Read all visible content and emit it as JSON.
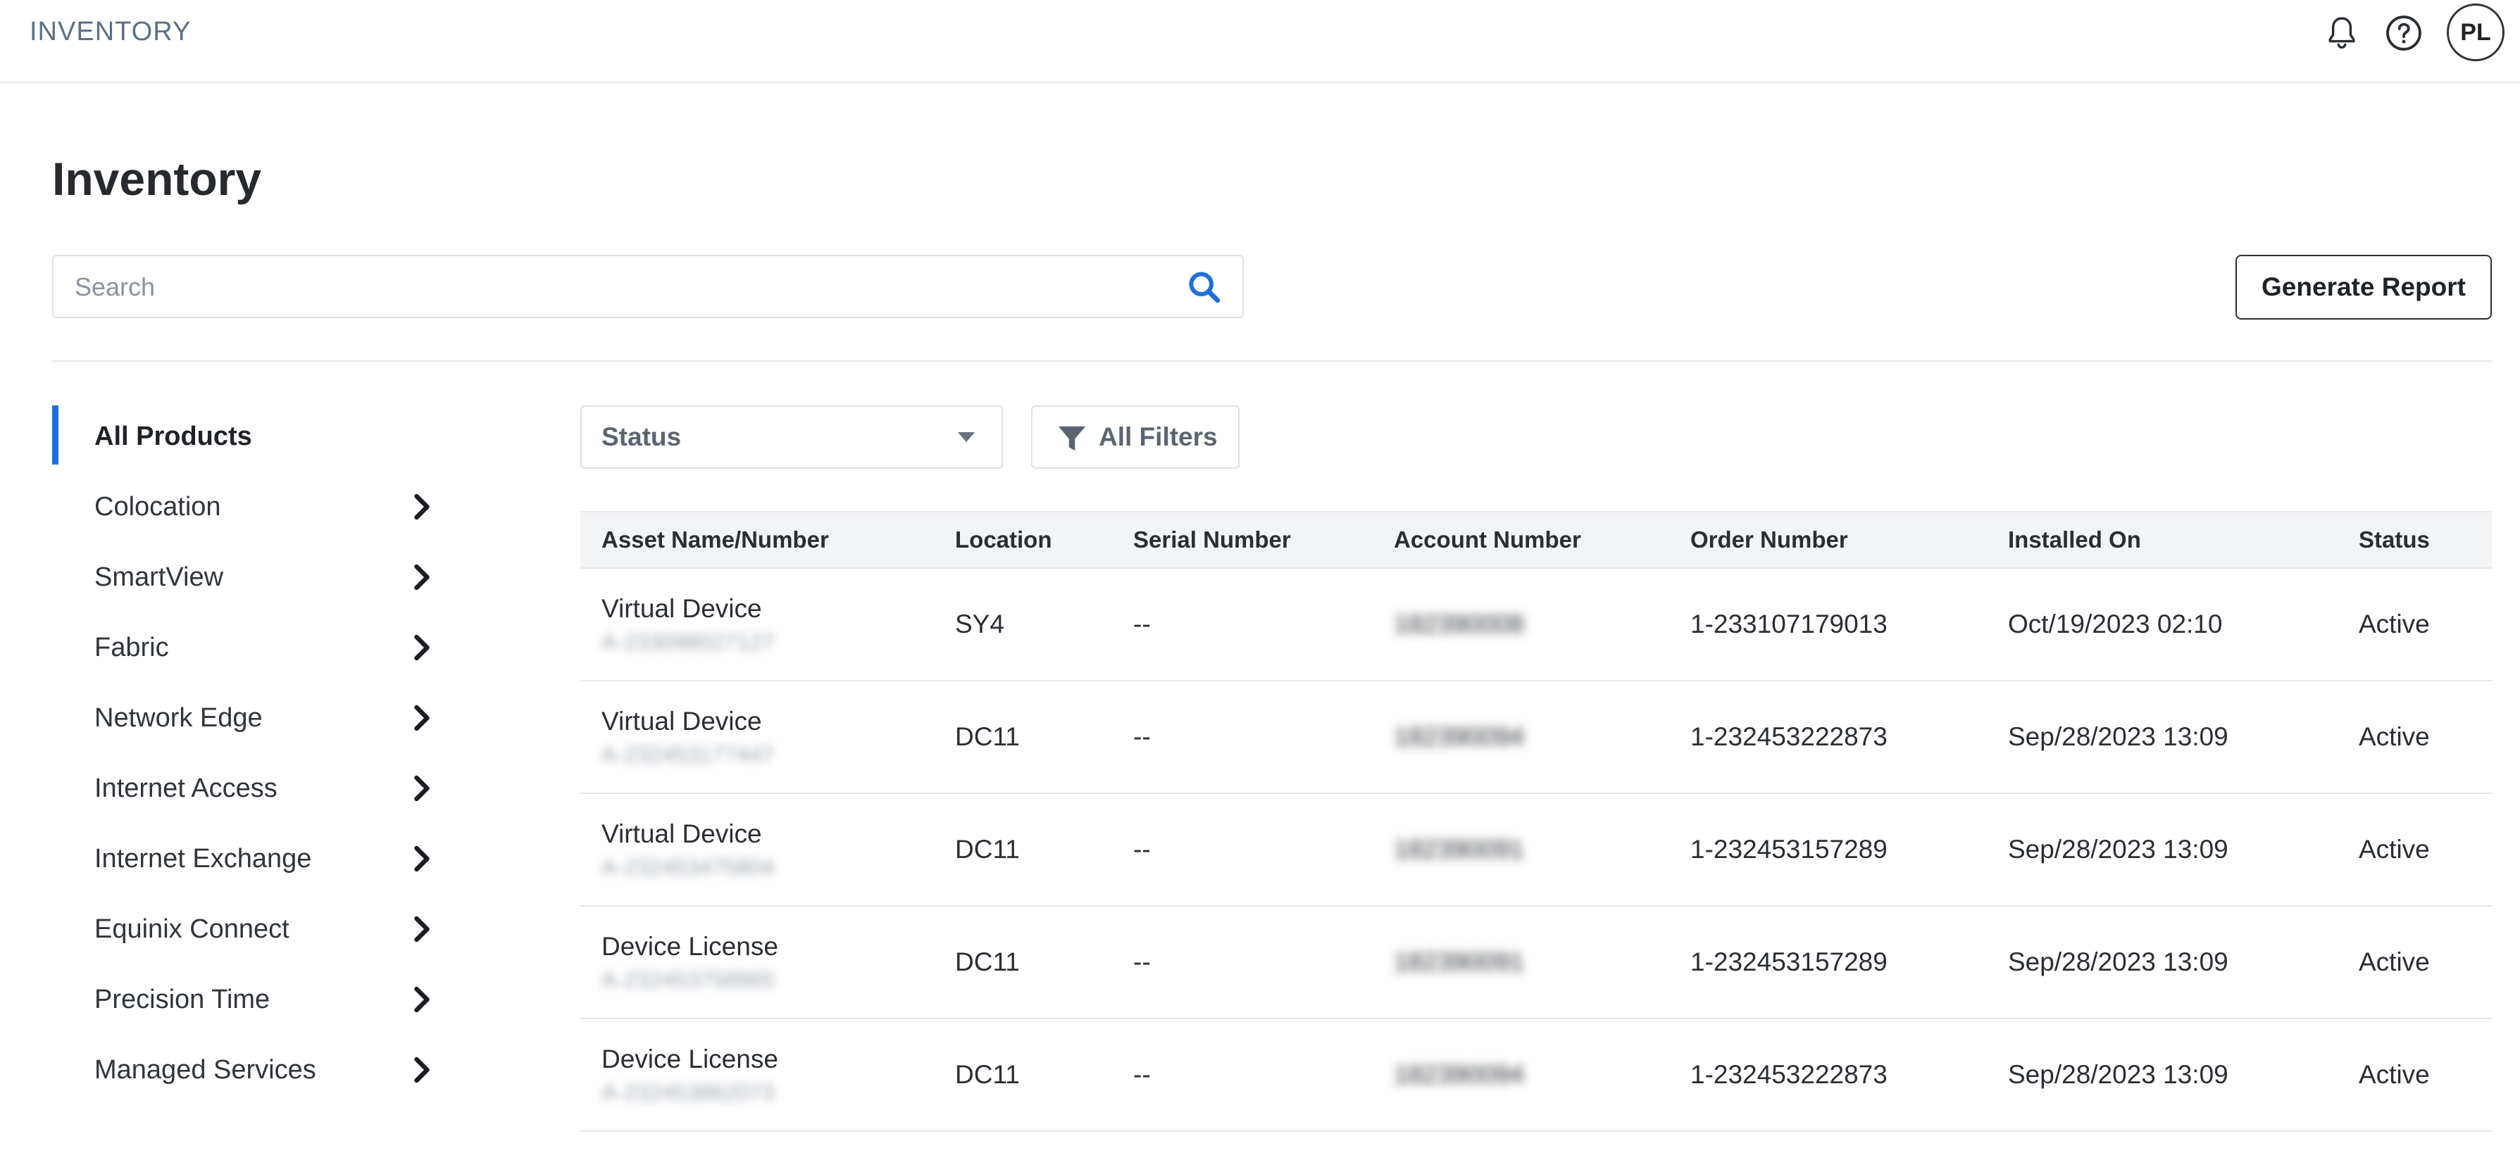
{
  "app": {
    "brand": "INVENTORY",
    "user_initials": "PL"
  },
  "page": {
    "title": "Inventory"
  },
  "search": {
    "placeholder": "Search",
    "value": ""
  },
  "actions": {
    "generate_report": "Generate Report"
  },
  "sidebar": {
    "items": [
      {
        "label": "All Products",
        "active": true
      },
      {
        "label": "Colocation"
      },
      {
        "label": "SmartView"
      },
      {
        "label": "Fabric"
      },
      {
        "label": "Network Edge"
      },
      {
        "label": "Internet Access"
      },
      {
        "label": "Internet Exchange"
      },
      {
        "label": "Equinix Connect"
      },
      {
        "label": "Precision Time"
      },
      {
        "label": "Managed Services"
      }
    ]
  },
  "filters": {
    "status_label": "Status",
    "all_filters_label": "All Filters"
  },
  "table": {
    "columns": [
      "Asset Name/Number",
      "Location",
      "Serial Number",
      "Account Number",
      "Order Number",
      "Installed On",
      "Status"
    ],
    "rows": [
      {
        "asset_name": "Virtual Device",
        "asset_number": "A-233098027127",
        "location": "SY4",
        "serial": "--",
        "account": "182390008",
        "order": "1-233107179013",
        "installed": "Oct/19/2023 02:10",
        "status": "Active"
      },
      {
        "asset_name": "Virtual Device",
        "asset_number": "A-232453177447",
        "location": "DC11",
        "serial": "--",
        "account": "182390094",
        "order": "1-232453222873",
        "installed": "Sep/28/2023 13:09",
        "status": "Active"
      },
      {
        "asset_name": "Virtual Device",
        "asset_number": "A-232453475804",
        "location": "DC11",
        "serial": "--",
        "account": "182390091",
        "order": "1-232453157289",
        "installed": "Sep/28/2023 13:09",
        "status": "Active"
      },
      {
        "asset_name": "Device License",
        "asset_number": "A-232453758965",
        "location": "DC11",
        "serial": "--",
        "account": "182390091",
        "order": "1-232453157289",
        "installed": "Sep/28/2023 13:09",
        "status": "Active"
      },
      {
        "asset_name": "Device License",
        "asset_number": "A-232453862073",
        "location": "DC11",
        "serial": "--",
        "account": "182390094",
        "order": "1-232453222873",
        "installed": "Sep/28/2023 13:09",
        "status": "Active"
      }
    ]
  },
  "colors": {
    "accent": "#1e6fd9",
    "brand_text": "#5b7085",
    "border": "#dde1e6",
    "header_bg": "#f3f4f6"
  }
}
